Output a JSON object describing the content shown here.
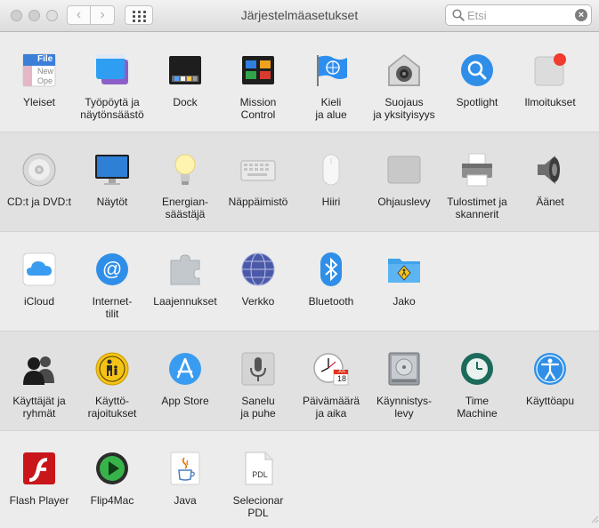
{
  "window": {
    "title": "Järjestelmäasetukset"
  },
  "search": {
    "placeholder": "Etsi",
    "value": ""
  },
  "sections": [
    {
      "items": [
        {
          "icon": "general-icon",
          "label": "Yleiset"
        },
        {
          "icon": "desktop-screensaver-icon",
          "label": "Työpöytä ja\nnäytönsäästö"
        },
        {
          "icon": "dock-icon",
          "label": "Dock"
        },
        {
          "icon": "mission-control-icon",
          "label": "Mission\nControl"
        },
        {
          "icon": "language-region-icon",
          "label": "Kieli\nja alue"
        },
        {
          "icon": "security-privacy-icon",
          "label": "Suojaus\nja yksityisyys"
        },
        {
          "icon": "spotlight-icon",
          "label": "Spotlight"
        },
        {
          "icon": "notifications-icon",
          "label": "Ilmoitukset"
        }
      ]
    },
    {
      "items": [
        {
          "icon": "cd-dvd-icon",
          "label": "CD:t ja DVD:t"
        },
        {
          "icon": "displays-icon",
          "label": "Näytöt"
        },
        {
          "icon": "energy-saver-icon",
          "label": "Energian-\nsäästäjä"
        },
        {
          "icon": "keyboard-icon",
          "label": "Näppäimistö"
        },
        {
          "icon": "mouse-icon",
          "label": "Hiiri"
        },
        {
          "icon": "trackpad-icon",
          "label": "Ohjauslevy"
        },
        {
          "icon": "printer-icon",
          "label": "Tulostimet ja\nskannerit"
        },
        {
          "icon": "sound-icon",
          "label": "Äänet"
        }
      ]
    },
    {
      "items": [
        {
          "icon": "icloud-icon",
          "label": "iCloud"
        },
        {
          "icon": "internet-accounts-icon",
          "label": "Internet-\ntilit"
        },
        {
          "icon": "extensions-icon",
          "label": "Laajennukset"
        },
        {
          "icon": "network-icon",
          "label": "Verkko"
        },
        {
          "icon": "bluetooth-icon",
          "label": "Bluetooth"
        },
        {
          "icon": "sharing-icon",
          "label": "Jako"
        }
      ]
    },
    {
      "items": [
        {
          "icon": "users-groups-icon",
          "label": "Käyttäjät ja\nryhmät"
        },
        {
          "icon": "parental-controls-icon",
          "label": "Käyttö-\nrajoitukset"
        },
        {
          "icon": "app-store-icon",
          "label": "App Store"
        },
        {
          "icon": "dictation-speech-icon",
          "label": "Sanelu\nja puhe"
        },
        {
          "icon": "date-time-icon",
          "label": "Päivämäärä\nja aika"
        },
        {
          "icon": "startup-disk-icon",
          "label": "Käynnistys-\nlevy"
        },
        {
          "icon": "time-machine-icon",
          "label": "Time\nMachine"
        },
        {
          "icon": "accessibility-icon",
          "label": "Käyttöapu"
        }
      ]
    },
    {
      "items": [
        {
          "icon": "flash-player-icon",
          "label": "Flash Player"
        },
        {
          "icon": "flip4mac-icon",
          "label": "Flip4Mac"
        },
        {
          "icon": "java-icon",
          "label": "Java"
        },
        {
          "icon": "selecionar-pdl-icon",
          "label": "Selecionar PDL"
        }
      ]
    }
  ],
  "icon_text": {
    "general_file": "File",
    "general_new": "New",
    "general_open": "Ope",
    "date_month": "JUL",
    "date_day": "18",
    "pdl": "PDL"
  },
  "colors": {
    "accent_blue": "#2f8fe8",
    "notification_red": "#f23a2f",
    "flash_red": "#c8161b"
  }
}
